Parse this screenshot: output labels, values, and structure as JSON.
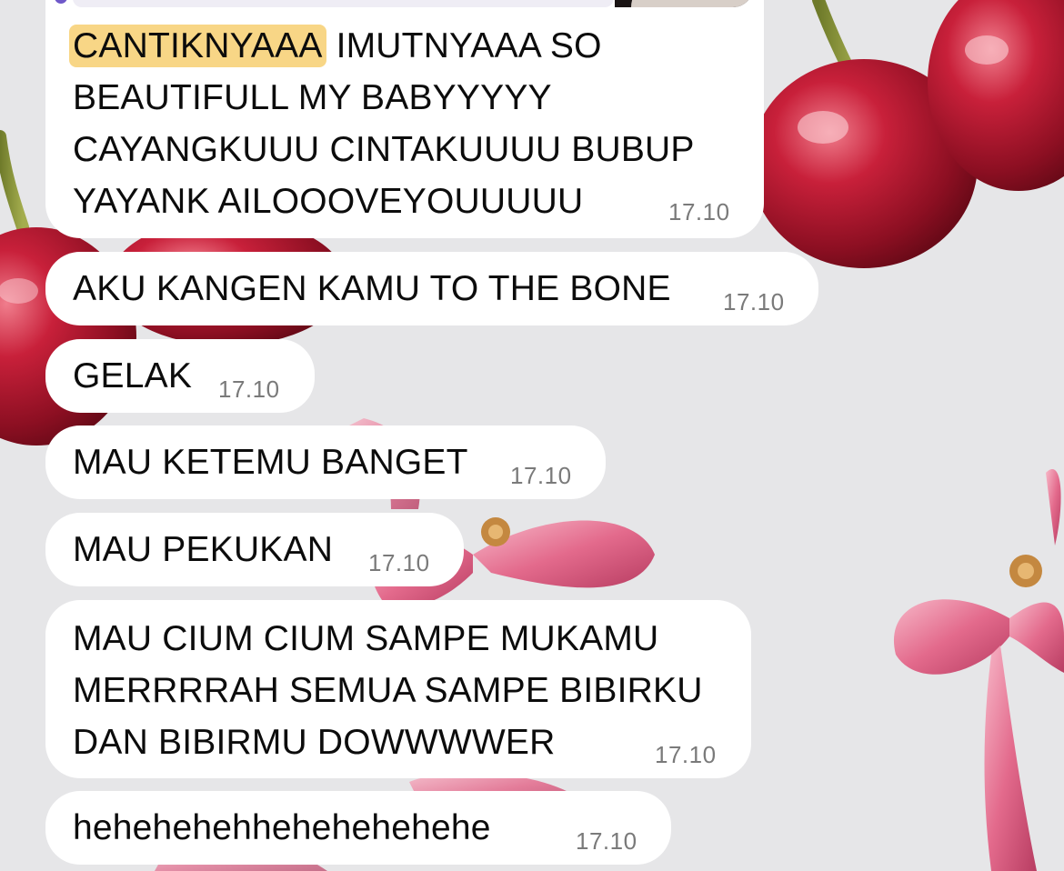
{
  "chat": {
    "reply_preview": {
      "thumbnail_icon": "photo-thumbnail",
      "accent_color": "#6f58c9"
    },
    "messages": [
      {
        "highlight": "CANTIKNYAAA",
        "text": " IMUTNYAAA SO\nBEAUTIFULL MY BABYYYYY\nCAYANGKUUU CINTAKUUUU BUBUP\nYAYANK AILOOOVEYOUUUUU",
        "time": "17.10"
      },
      {
        "text": "AKU KANGEN KAMU TO THE BONE",
        "time": "17.10"
      },
      {
        "text": "GELAK",
        "time": "17.10"
      },
      {
        "text": "MAU KETEMU BANGET",
        "time": "17.10"
      },
      {
        "text": "MAU PEKUKAN",
        "time": "17.10"
      },
      {
        "text": "MAU CIUM CIUM SAMPE MUKAMU\nMERRRRAH SEMUA SAMPE BIBIRKU\nDAN BIBIRMU DOWWWWER",
        "time": "17.10"
      },
      {
        "text": "hehehehehhehehehehehe",
        "time": "17.10"
      }
    ]
  },
  "theme": {
    "bubble_color": "#ffffff",
    "highlight_color": "#f8d686",
    "time_color": "#7a7a7a",
    "wallpaper": "cherries-and-pink-ribbons"
  }
}
